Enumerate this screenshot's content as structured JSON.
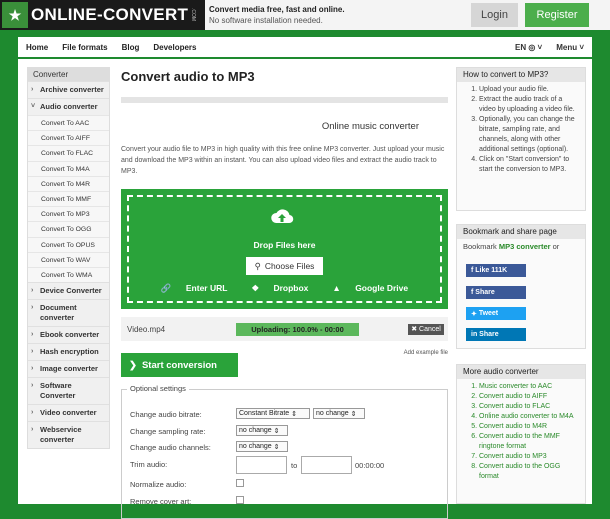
{
  "header": {
    "logo_text": "ONLINE-CONVERT",
    "logo_dotcom": ".COM",
    "tagline_bold": "Convert media free, fast and online.",
    "tagline_sub": "No software installation needed.",
    "login": "Login",
    "register": "Register"
  },
  "nav": {
    "items": [
      "Home",
      "File formats",
      "Blog",
      "Developers"
    ],
    "lang": "EN ◎ ˅",
    "menu": "Menu ˅"
  },
  "sidebar": {
    "title": "Converter",
    "before": [
      "Archive converter"
    ],
    "open_cat": "Audio converter",
    "subs": [
      "Convert To AAC",
      "Convert To AIFF",
      "Convert To FLAC",
      "Convert To M4A",
      "Convert To M4R",
      "Convert To MMF",
      "Convert To MP3",
      "Convert To OGG",
      "Convert To OPUS",
      "Convert To WAV",
      "Convert To WMA"
    ],
    "after": [
      "Device Converter",
      "Document converter",
      "Ebook converter",
      "Hash encryption",
      "Image converter",
      "Software Converter",
      "Video converter",
      "Webservice converter"
    ]
  },
  "main": {
    "title": "Convert audio to MP3",
    "subtitle": "Online music converter",
    "description": "Convert your audio file to MP3 in high quality with this free online MP3 converter. Just upload your music and download the MP3 within an instant. You can also upload video files and extract the audio track to MP3.",
    "drop_text": "Drop Files here",
    "choose": "Choose Files",
    "enter_url": "Enter URL",
    "dropbox": "Dropbox",
    "gdrive": "Google Drive",
    "file_name": "Video.mp4",
    "progress": "Uploading:  100.0% - 00:00",
    "cancel": "Cancel",
    "add_example": "Add example file",
    "start": "Start conversion",
    "optional_title": "Optional settings",
    "opt_bitrate": "Change audio bitrate:",
    "opt_bitrate_val": "Constant Bitrate",
    "opt_bitrate_val2": "no change",
    "opt_sampling": "Change sampling rate:",
    "opt_sampling_val": "no change",
    "opt_channels": "Change audio channels:",
    "opt_channels_val": "no change",
    "opt_trim": "Trim audio:",
    "opt_trim_to": "to",
    "opt_trim_time": "00:00:00",
    "opt_normalize": "Normalize audio:",
    "opt_cover": "Remove cover art:"
  },
  "howto": {
    "title": "How to convert to MP3?",
    "steps": [
      "Upload your audio file.",
      "Extract the audio track of a video by uploading a video file.",
      "Optionally, you can change the bitrate, sampling rate, and channels, along with other additional settings (optional).",
      "Click on \"Start conversion\" to start the conversion to MP3."
    ]
  },
  "bookmark": {
    "title": "Bookmark and share page",
    "text_pre": "Bookmark",
    "text_link": "MP3 converter",
    "text_post": "or",
    "like": "Like 111K",
    "share_fb": "Share",
    "tweet": "Tweet",
    "share_in": "Share"
  },
  "more": {
    "title": "More audio converter",
    "items": [
      "Music converter to AAC",
      "Convert audio to AIFF",
      "Convert audio to FLAC",
      "Online audio converter to M4A",
      "Convert audio to M4R",
      "Convert audio to the MMF ringtone format",
      "Convert audio to MP3",
      "Convert audio to the OGG format"
    ]
  },
  "colors": {
    "brand_green": "#2aa33a",
    "facebook": "#3b5998",
    "twitter": "#1da1f2",
    "linkedin": "#0077b5"
  }
}
